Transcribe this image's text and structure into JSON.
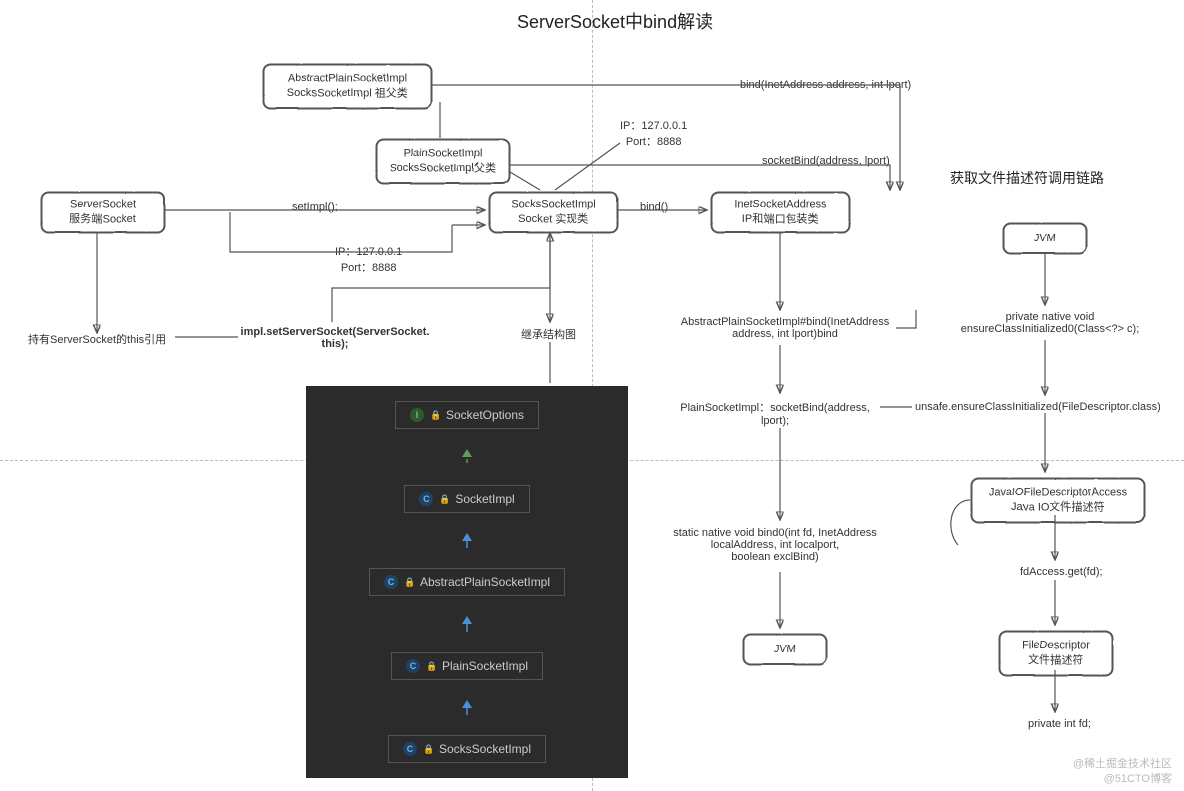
{
  "title": "ServerSocket中bind解读",
  "subtitle_right": "获取文件描述符调用链路",
  "boxes": {
    "abstractPlain": {
      "l1": "AbstractPlainSocketImpl",
      "l2": "SocksSocketImpl 祖父类"
    },
    "plainSocket": {
      "l1": "PlainSocketImpl",
      "l2": "SocksSocketImpl父类"
    },
    "serverSocket": {
      "l1": "ServerSocket",
      "l2": "服务端Socket"
    },
    "socksSocket": {
      "l1": "SocksSocketImpl",
      "l2": "Socket 实现类"
    },
    "inetAddr": {
      "l1": "InetSocketAddress",
      "l2": "IP和端口包装类"
    },
    "jvm1": "JVM",
    "jvm2": "JVM",
    "javaIO": {
      "l1": "JavaIOFileDescriptorAccess",
      "l2": "Java IO文件描述符"
    },
    "fileDesc": {
      "l1": "FileDescriptor",
      "l2": "文件描述符"
    }
  },
  "labels": {
    "setImpl": "setImpl();",
    "ipPort1": {
      "l1": "IP：127.0.0.1",
      "l2": "Port：8888"
    },
    "ipPort2": {
      "l1": "IP：127.0.0.1",
      "l2": "Port：8888"
    },
    "bindCall": "bind()",
    "bindInet": "bind(InetAddress address, int lport)",
    "socketBind": "socketBind(address, lport)",
    "holdThis": "持有ServerSocket的this引用",
    "implSetServer": "impl.setServerSocket(ServerSocket.\nthis);",
    "inheritDiagram": "继承结构图",
    "abstractBindCall": {
      "l1": "AbstractPlainSocketImpl#bind(InetAddress",
      "l2": "address, int lport)bind"
    },
    "plainSocketBind": {
      "l1": "PlainSocketImpl：socketBind(address,",
      "l2": "lport);"
    },
    "nativeBind0": {
      "l1": "static native void bind0(int fd, InetAddress",
      "l2": "localAddress, int localport,",
      "l3": "boolean exclBind)"
    },
    "privateNative": {
      "l1": "private native void",
      "l2": "ensureClassInitialized0(Class<?> c);"
    },
    "unsafeEnsure": "unsafe.ensureClassInitialized(FileDescriptor.class)",
    "fdAccessGet": "fdAccess.get(fd);",
    "privateIntFd": "private int fd;"
  },
  "uml": {
    "items": [
      {
        "kind": "interface",
        "icon": "I",
        "name": "SocketOptions"
      },
      {
        "kind": "class",
        "icon": "C",
        "name": "SocketImpl"
      },
      {
        "kind": "class",
        "icon": "C",
        "name": "AbstractPlainSocketImpl"
      },
      {
        "kind": "class",
        "icon": "C",
        "name": "PlainSocketImpl"
      },
      {
        "kind": "class",
        "icon": "C",
        "name": "SocksSocketImpl"
      }
    ]
  },
  "watermark1": "@稀土掘金技术社区",
  "watermark2": "@51CTO博客"
}
